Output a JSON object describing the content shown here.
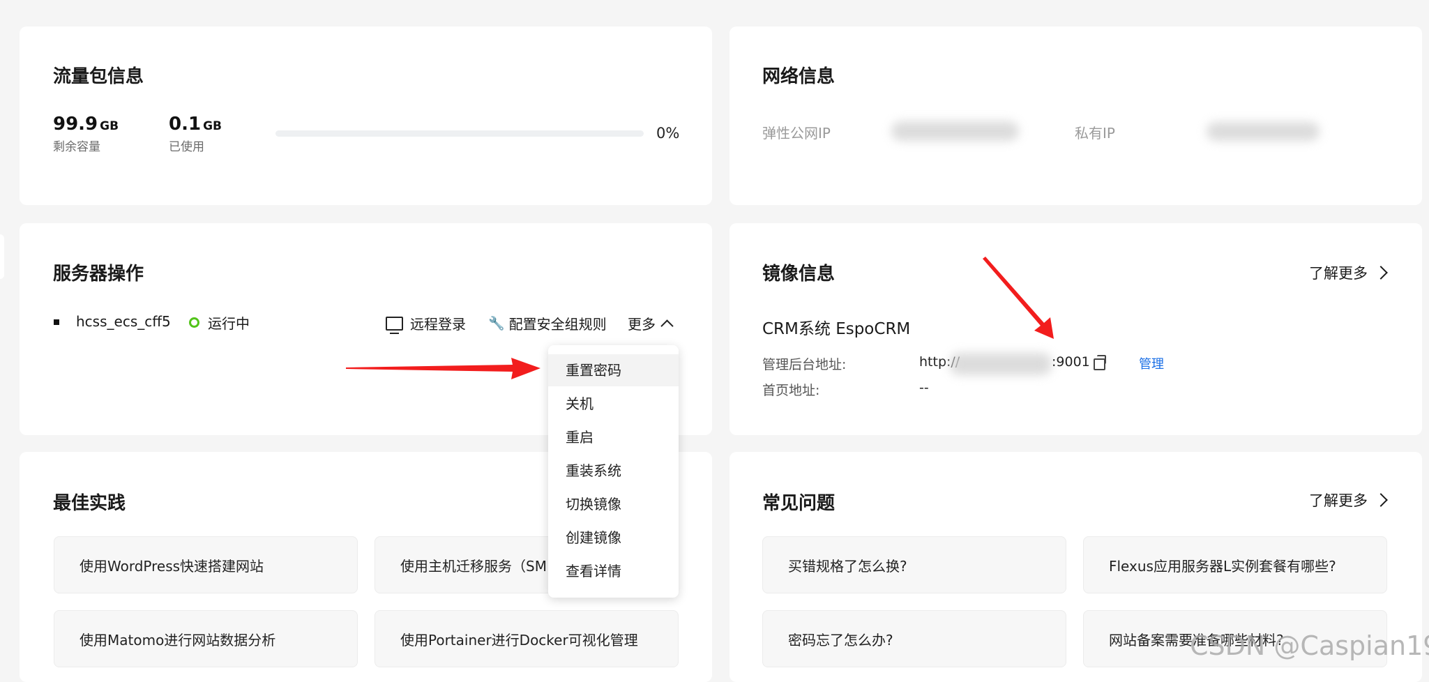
{
  "traffic": {
    "title": "流量包信息",
    "remaining_value": "99.9",
    "remaining_unit": "GB",
    "remaining_label": "剩余容量",
    "used_value": "0.1",
    "used_unit": "GB",
    "used_label": "已使用",
    "usage_percent_text": "0%",
    "usage_fraction": 0,
    "bar_color": "#5b8ff9"
  },
  "network": {
    "title": "网络信息",
    "public_ip_label": "弹性公网IP",
    "private_ip_label": "私有IP"
  },
  "server": {
    "title": "服务器操作",
    "name": "hcss_ecs_cff5",
    "status": "运行中",
    "status_color": "#52c41a",
    "remote_login": "远程登录",
    "security_rules": "配置安全组规则",
    "more": "更多",
    "menu": [
      "重置密码",
      "关机",
      "重启",
      "重装系统",
      "切换镜像",
      "创建镜像",
      "查看详情"
    ]
  },
  "image": {
    "title": "镜像信息",
    "learn_more": "了解更多",
    "name": "CRM系统 EspoCRM",
    "admin_label": "管理后台地址:",
    "admin_prefix": "http://",
    "admin_port": ":9001",
    "manage": "管理",
    "home_label": "首页地址:",
    "home_value": "--",
    "link_color": "#1a6fe6"
  },
  "best_practice": {
    "title": "最佳实践",
    "items": [
      "使用WordPress快速搭建网站",
      "使用主机迁移服务（SM",
      "使用Matomo进行网站数据分析",
      "使用Portainer进行Docker可视化管理"
    ]
  },
  "faq": {
    "title": "常见问题",
    "learn_more": "了解更多",
    "items": [
      "买错规格了怎么换?",
      "Flexus应用服务器L实例套餐有哪些?",
      "密码忘了怎么办?",
      "网站备案需要准备哪些材料?"
    ]
  },
  "watermark": "CSDN @Caspian19",
  "annotation_color": "#f21d1d"
}
